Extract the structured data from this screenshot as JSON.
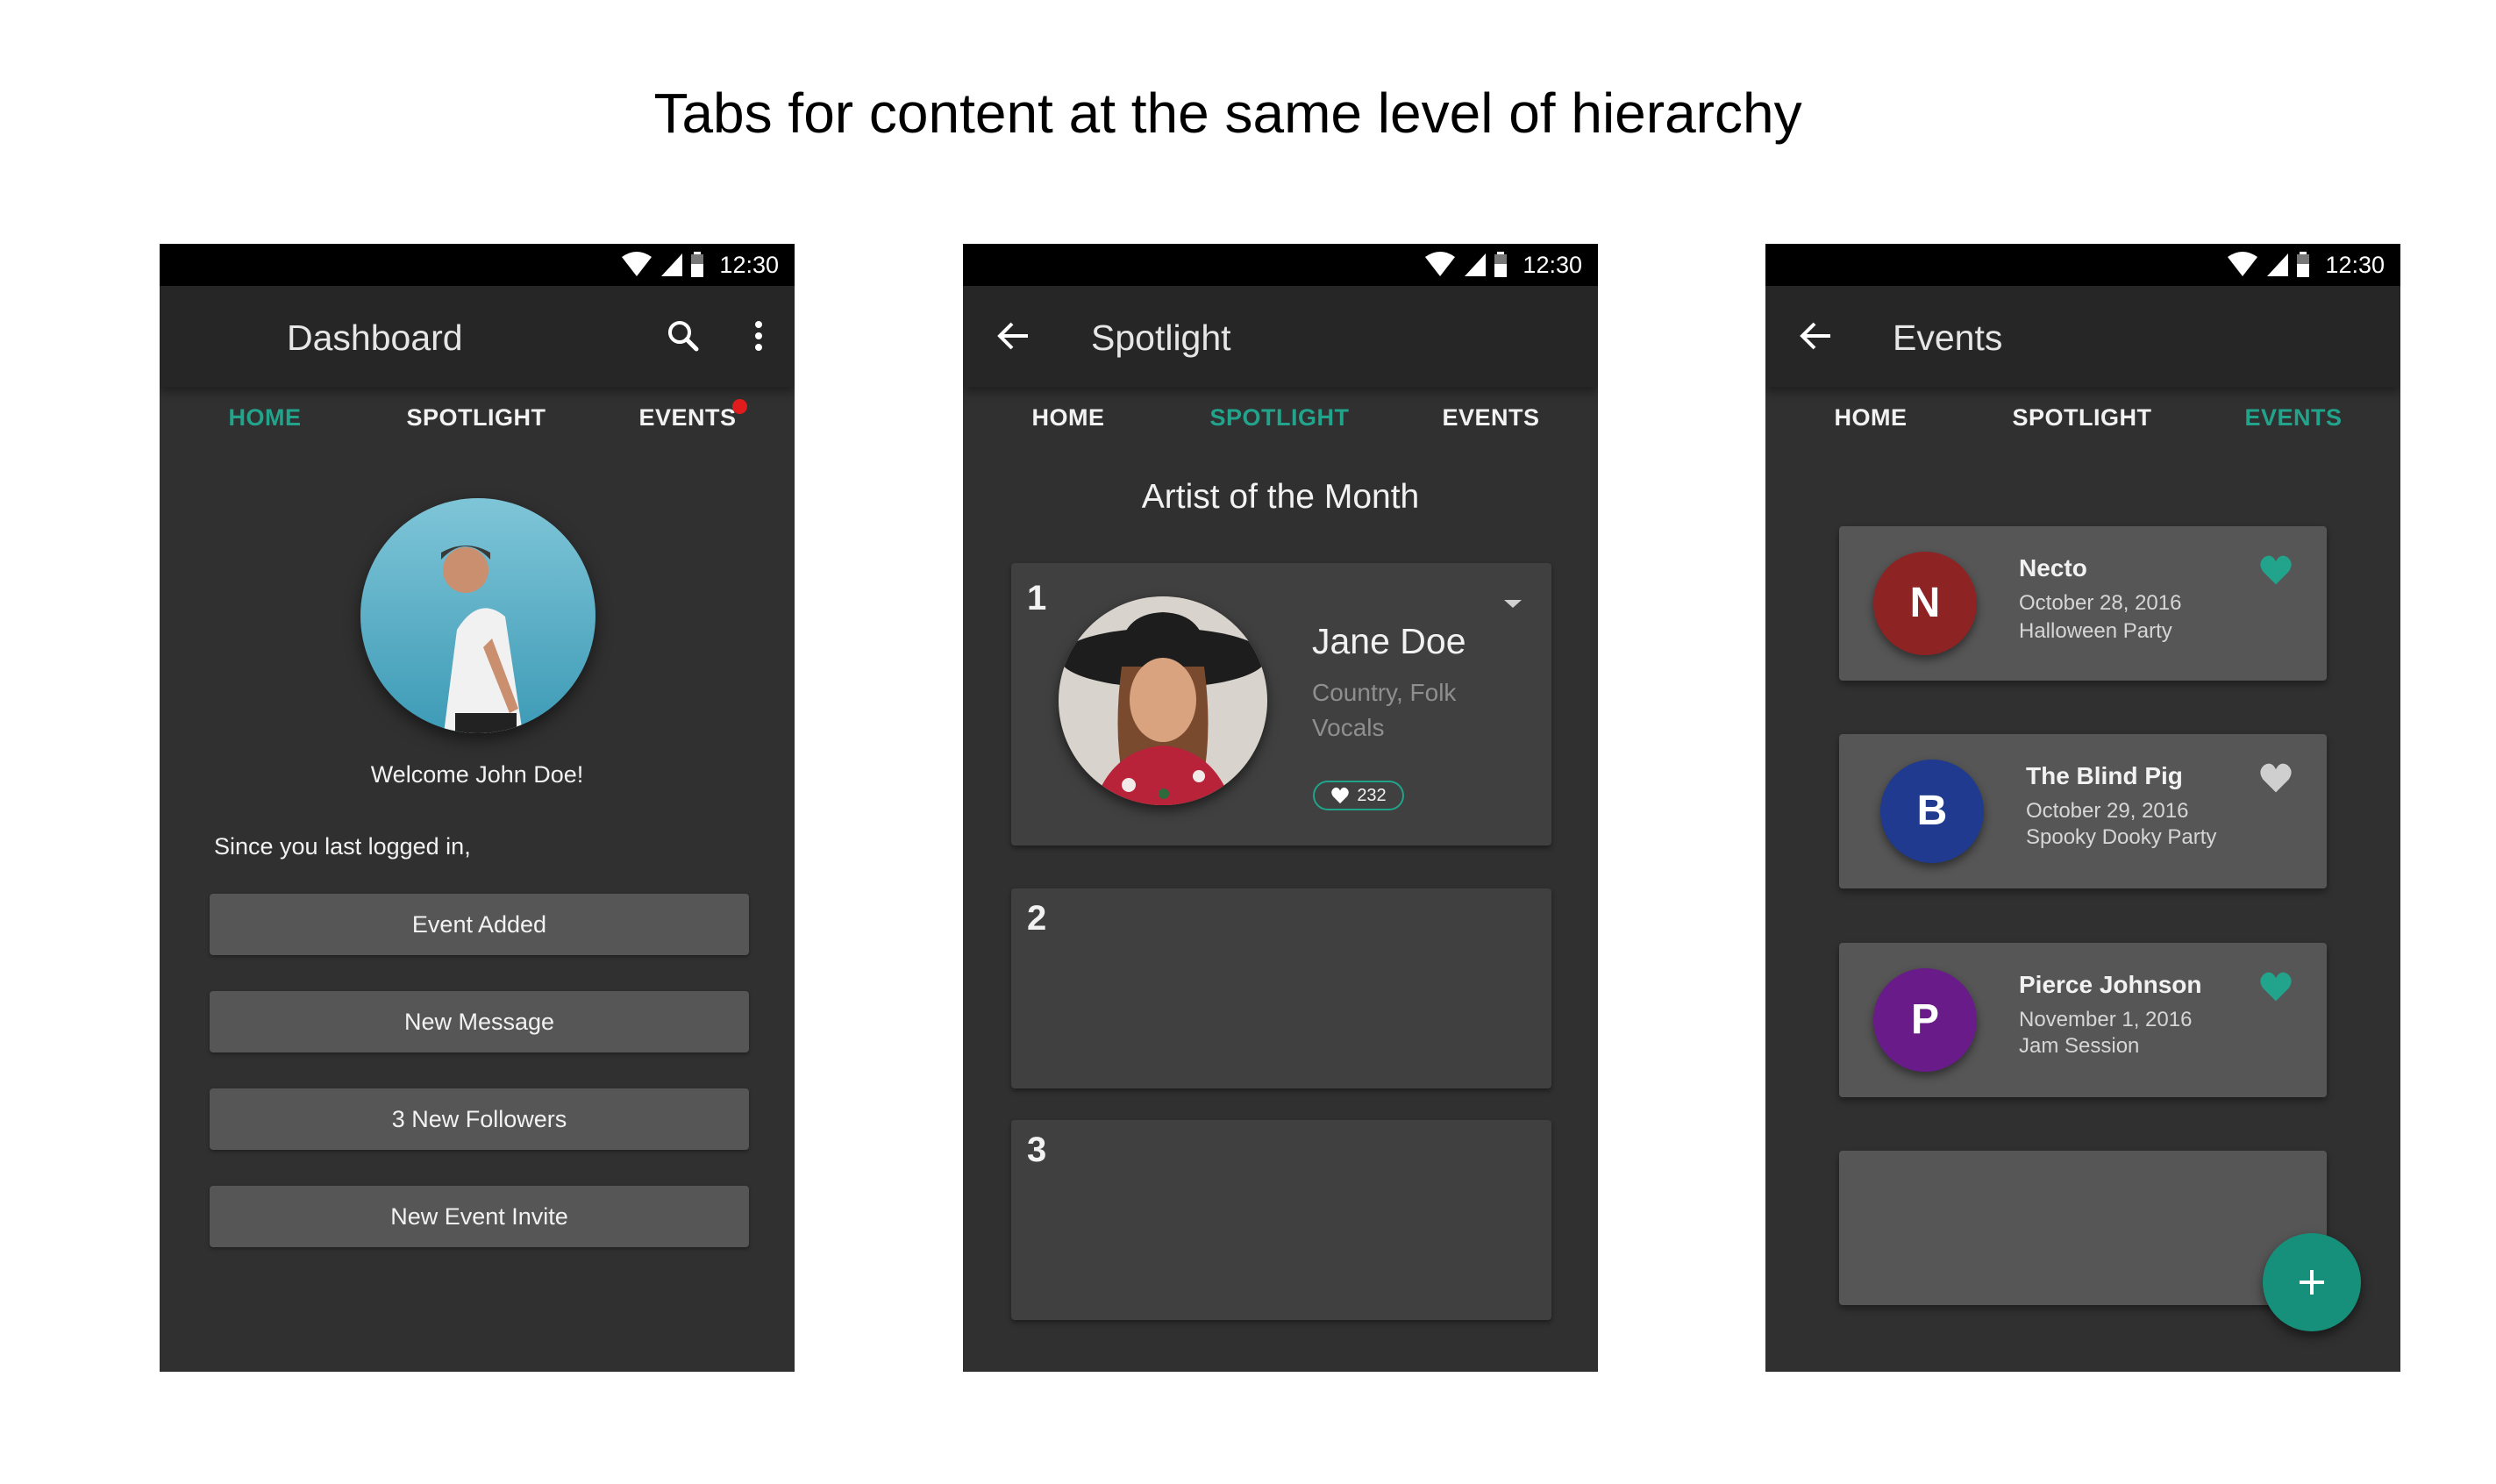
{
  "heading": "Tabs for content at the same level of hierarchy",
  "status_time": "12:30",
  "accent_color": "#21a48b",
  "tabs": [
    "HOME",
    "SPOTLIGHT",
    "EVENTS"
  ],
  "dashboard": {
    "title": "Dashboard",
    "active_tab": "HOME",
    "welcome": "Welcome John Doe!",
    "since": "Since you last logged in,",
    "buttons": [
      "Event Added",
      "New Message",
      "3 New Followers",
      "New Event Invite"
    ]
  },
  "spotlight": {
    "title": "Spotlight",
    "active_tab": "SPOTLIGHT",
    "section": "Artist of the Month",
    "ranks": [
      "1",
      "2",
      "3"
    ],
    "artist": {
      "name": "Jane Doe",
      "genre": "Country, Folk",
      "role": "Vocals",
      "likes": "232"
    }
  },
  "events": {
    "title": "Events",
    "active_tab": "EVENTS",
    "items": [
      {
        "initial": "N",
        "name": "Necto",
        "date": "October 28, 2016",
        "desc": "Halloween Party",
        "color": "#8e2323",
        "favorited": true
      },
      {
        "initial": "B",
        "name": "The Blind Pig",
        "date": "October 29, 2016",
        "desc": "Spooky Dooky Party",
        "color": "#1f3a8f",
        "favorited": false
      },
      {
        "initial": "P",
        "name": "Pierce Johnson",
        "date": "November 1, 2016",
        "desc": "Jam Session",
        "color": "#6a1b8a",
        "favorited": true
      }
    ],
    "fab_icon": "plus-icon"
  }
}
